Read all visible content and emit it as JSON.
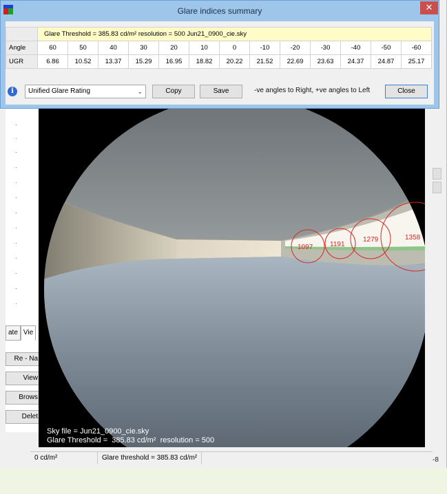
{
  "dialog": {
    "title": "Glare indices summary",
    "close_glyph": "✕",
    "info_line": "Glare Threshold = 385.83 cd/m²    resolution = 500    Jun21_0900_cie.sky",
    "angle_label": "Angle",
    "ugr_label": "UGR",
    "angles": [
      "60",
      "50",
      "40",
      "30",
      "20",
      "10",
      "0",
      "-10",
      "-20",
      "-30",
      "-40",
      "-50",
      "-60"
    ],
    "ugr_values": [
      "6.86",
      "10.52",
      "13.37",
      "15.29",
      "16.95",
      "18.82",
      "20.22",
      "21.52",
      "22.69",
      "23.63",
      "24.37",
      "24.87",
      "25.17"
    ],
    "metric_selected": "Unified Glare Rating",
    "copy_label": "Copy",
    "save_label": "Save",
    "direction_note": "-ve angles to Right, +ve angles to Left",
    "close_label": "Close",
    "info_icon": "info-icon",
    "chevron": "⌄"
  },
  "side": {
    "tab_left": "ate",
    "tab_right": "Vie",
    "btn_rename": "Re - Na",
    "btn_view": "View",
    "btn_browse": "Brows",
    "btn_delete": "Delet",
    "dot": "·"
  },
  "image": {
    "sky_line": "Sky file = Jun21_0900_cie.sky",
    "threshold_line": "Glare Threshold =  385.83 cd/m²  resolution = 500",
    "markers": [
      {
        "label": "1097"
      },
      {
        "label": "1191"
      },
      {
        "label": "1279"
      },
      {
        "label": "1358"
      }
    ]
  },
  "status": {
    "luminance": "0 cd/m²",
    "threshold": "Glare threshold =  385.83 cd/m²"
  },
  "right_edge_label": "-8",
  "colors": {
    "marker_red": "#d62828",
    "dialog_frame": "#9ec6ea",
    "close_red": "#c94f4f",
    "info_row": "#fffcc8"
  }
}
